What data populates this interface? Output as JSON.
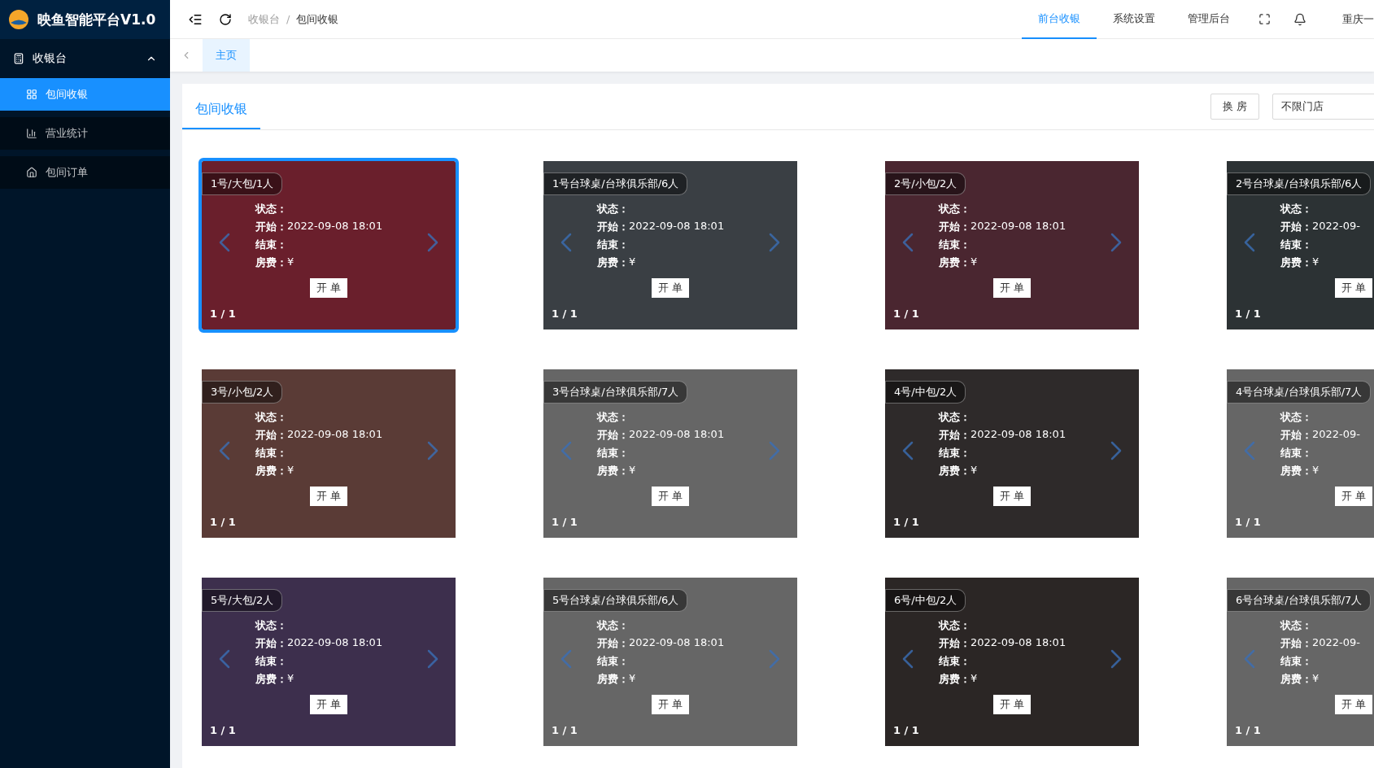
{
  "brand": {
    "title": "映鱼智能平台V1.0"
  },
  "sidebar": {
    "groups": [
      {
        "label": "收银台",
        "expanded": true,
        "children": [
          {
            "label": "包间收银",
            "selected": true
          },
          {
            "label": "营业统计",
            "selected": false
          },
          {
            "label": "包间订单",
            "selected": false
          }
        ]
      }
    ]
  },
  "breadcrumb": {
    "items": [
      "收银台",
      "包间收银"
    ],
    "separator": "/"
  },
  "top_nav": [
    {
      "label": "前台收银",
      "selected": true
    },
    {
      "label": "系统设置",
      "selected": false
    },
    {
      "label": "管理后台",
      "selected": false
    }
  ],
  "user": "重庆一",
  "page_tabs": [
    {
      "label": "主页",
      "selected": true
    }
  ],
  "panel": {
    "tabs": [
      {
        "label": "包间收银",
        "selected": true
      }
    ],
    "swap_button": "换 房",
    "store_select": {
      "value": "不限门店"
    }
  },
  "rooms": [
    {
      "kind": "full",
      "selected": true,
      "title": "1号/大包/1人",
      "lines": [
        {
          "label": "状态："
        },
        {
          "label": "开始：",
          "value": "2022-09-08 18:01"
        },
        {
          "label": "结束："
        },
        {
          "label": "房费：",
          "value": "¥"
        }
      ],
      "button": "开 单",
      "counter": "1 / 1"
    },
    {
      "kind": "full",
      "selected": false,
      "title": "1号台球桌/台球俱乐部/6人",
      "lines": [
        {
          "label": "状态："
        },
        {
          "label": "开始：",
          "value": "2022-09-08 18:01"
        },
        {
          "label": "结束："
        },
        {
          "label": "房费：",
          "value": "¥"
        }
      ],
      "button": "开 单",
      "counter": "1 / 1"
    },
    {
      "kind": "full",
      "selected": false,
      "title": "2号/小包/2人",
      "lines": [
        {
          "label": "状态："
        },
        {
          "label": "开始：",
          "value": "2022-09-08 18:01"
        },
        {
          "label": "结束："
        },
        {
          "label": "房费：",
          "value": "¥"
        }
      ],
      "button": "开 单",
      "counter": "1 / 1"
    },
    {
      "kind": "cut",
      "selected": false,
      "title": "2号台球桌/台球俱乐部/6人",
      "lines": [
        {
          "label": "状态："
        },
        {
          "label": "开始：",
          "value": "2022-09-"
        },
        {
          "label": "结束："
        },
        {
          "label": "房费：",
          "value": "¥"
        }
      ],
      "button": "开 单",
      "counter": "1 / 1"
    },
    {
      "kind": "full",
      "selected": false,
      "title": "3号/小包/2人",
      "lines": [
        {
          "label": "状态："
        },
        {
          "label": "开始：",
          "value": "2022-09-08 18:01"
        },
        {
          "label": "结束："
        },
        {
          "label": "房费：",
          "value": "¥"
        }
      ],
      "button": "开 单",
      "counter": "1 / 1"
    },
    {
      "kind": "full",
      "selected": false,
      "title": "3号台球桌/台球俱乐部/7人",
      "lines": [
        {
          "label": "状态："
        },
        {
          "label": "开始：",
          "value": "2022-09-08 18:01"
        },
        {
          "label": "结束："
        },
        {
          "label": "房费：",
          "value": "¥"
        }
      ],
      "button": "开 单",
      "counter": "1 / 1"
    },
    {
      "kind": "full",
      "selected": false,
      "title": "4号/中包/2人",
      "lines": [
        {
          "label": "状态："
        },
        {
          "label": "开始：",
          "value": "2022-09-08 18:01"
        },
        {
          "label": "结束："
        },
        {
          "label": "房费：",
          "value": "¥"
        }
      ],
      "button": "开 单",
      "counter": "1 / 1"
    },
    {
      "kind": "cut",
      "selected": false,
      "title": "4号台球桌/台球俱乐部/7人",
      "lines": [
        {
          "label": "状态："
        },
        {
          "label": "开始：",
          "value": "2022-09-"
        },
        {
          "label": "结束："
        },
        {
          "label": "房费：",
          "value": "¥"
        }
      ],
      "button": "开 单",
      "counter": "1 / 1"
    },
    {
      "kind": "full",
      "selected": false,
      "title": "5号/大包/2人",
      "lines": [
        {
          "label": "状态："
        },
        {
          "label": "开始：",
          "value": "2022-09-08 18:01"
        },
        {
          "label": "结束："
        },
        {
          "label": "房费：",
          "value": "¥"
        }
      ],
      "button": "开 单",
      "counter": "1 / 1"
    },
    {
      "kind": "full",
      "selected": false,
      "title": "5号台球桌/台球俱乐部/6人",
      "lines": [
        {
          "label": "状态："
        },
        {
          "label": "开始：",
          "value": "2022-09-08 18:01"
        },
        {
          "label": "结束："
        },
        {
          "label": "房费：",
          "value": "¥"
        }
      ],
      "button": "开 单",
      "counter": "1 / 1"
    },
    {
      "kind": "full",
      "selected": false,
      "title": "6号/中包/2人",
      "lines": [
        {
          "label": "状态："
        },
        {
          "label": "开始：",
          "value": "2022-09-08 18:01"
        },
        {
          "label": "结束："
        },
        {
          "label": "房费：",
          "value": "¥"
        }
      ],
      "button": "开 单",
      "counter": "1 / 1"
    },
    {
      "kind": "cut",
      "selected": false,
      "title": "6号台球桌/台球俱乐部/7人",
      "lines": [
        {
          "label": "状态："
        },
        {
          "label": "开始：",
          "value": "2022-09-"
        },
        {
          "label": "结束："
        },
        {
          "label": "房费：",
          "value": "¥"
        }
      ],
      "button": "开 单",
      "counter": "1 / 1"
    }
  ]
}
